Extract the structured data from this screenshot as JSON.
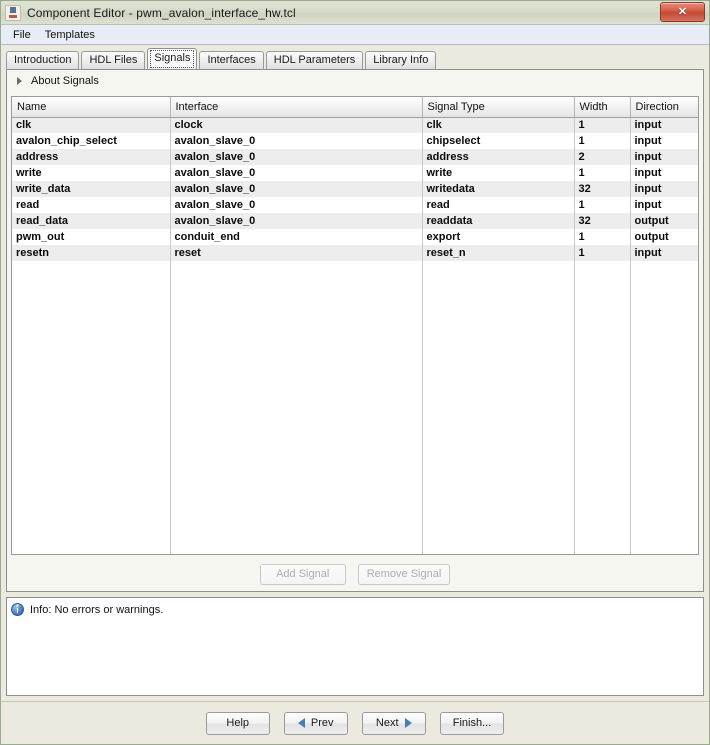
{
  "window": {
    "title": "Component Editor - pwm_avalon_interface_hw.tcl",
    "icon": "component-editor-icon",
    "close_label": "✕"
  },
  "menubar": {
    "items": [
      {
        "label": "File"
      },
      {
        "label": "Templates"
      }
    ]
  },
  "tabs": [
    {
      "label": "Introduction",
      "selected": false
    },
    {
      "label": "HDL Files",
      "selected": false
    },
    {
      "label": "Signals",
      "selected": true
    },
    {
      "label": "Interfaces",
      "selected": false
    },
    {
      "label": "HDL Parameters",
      "selected": false
    },
    {
      "label": "Library Info",
      "selected": false
    }
  ],
  "about": {
    "label": "About Signals",
    "expanded": false
  },
  "table": {
    "columns": [
      "Name",
      "Interface",
      "Signal Type",
      "Width",
      "Direction"
    ],
    "rows": [
      {
        "name": "clk",
        "interface": "clock",
        "signal_type": "clk",
        "width": "1",
        "direction": "input"
      },
      {
        "name": "avalon_chip_select",
        "interface": "avalon_slave_0",
        "signal_type": "chipselect",
        "width": "1",
        "direction": "input"
      },
      {
        "name": "address",
        "interface": "avalon_slave_0",
        "signal_type": "address",
        "width": "2",
        "direction": "input"
      },
      {
        "name": "write",
        "interface": "avalon_slave_0",
        "signal_type": "write",
        "width": "1",
        "direction": "input"
      },
      {
        "name": "write_data",
        "interface": "avalon_slave_0",
        "signal_type": "writedata",
        "width": "32",
        "direction": "input"
      },
      {
        "name": "read",
        "interface": "avalon_slave_0",
        "signal_type": "read",
        "width": "1",
        "direction": "input"
      },
      {
        "name": "read_data",
        "interface": "avalon_slave_0",
        "signal_type": "readdata",
        "width": "32",
        "direction": "output"
      },
      {
        "name": "pwm_out",
        "interface": "conduit_end",
        "signal_type": "export",
        "width": "1",
        "direction": "output"
      },
      {
        "name": "resetn",
        "interface": "reset",
        "signal_type": "reset_n",
        "width": "1",
        "direction": "input"
      }
    ]
  },
  "table_buttons": {
    "add": "Add Signal",
    "remove": "Remove Signal"
  },
  "info": {
    "message": "Info: No errors or warnings.",
    "icon": "info-icon",
    "color": "#2c5f9e"
  },
  "wizard_buttons": {
    "help": "Help",
    "prev": "Prev",
    "next": "Next",
    "finish": "Finish..."
  },
  "colors": {
    "window_bg": "#eceadf",
    "panel_bg": "#f6f6f0",
    "row_stripe": "#ededed",
    "arrow_blue": "#4a7ebb",
    "close_red": "#c14a33"
  }
}
